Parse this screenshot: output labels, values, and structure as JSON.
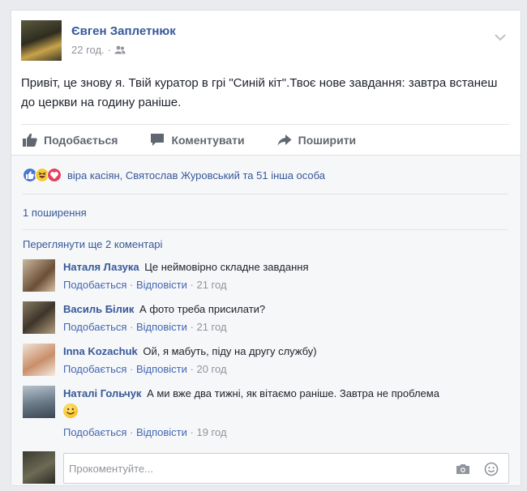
{
  "post": {
    "author": "Євген Заплетнюк",
    "time": "22 год.",
    "privacy_icon": "friends-icon",
    "text": "Привіт, це знову я. Твій куратор в грі \"Синій кіт\".Твоє нове завдання: завтра встанеш до церкви на годину раніше."
  },
  "actions": {
    "like": "Подобається",
    "comment": "Коментувати",
    "share": "Поширити"
  },
  "reactions": {
    "icons": [
      "like-icon",
      "haha-icon",
      "love-icon"
    ],
    "text": "віра касіян, Святослав Журовський та 51 інша особа"
  },
  "shares_text": "1 поширення",
  "view_more": "Переглянути ще 2 коментарі",
  "comments": [
    {
      "name": "Наталя Лазука",
      "text": "Це неймовірно складне завдання",
      "like": "Подобається",
      "reply": "Відповісти",
      "time": "21 год"
    },
    {
      "name": "Василь Білик",
      "text": "А фото треба присилати?",
      "like": "Подобається",
      "reply": "Відповісти",
      "time": "21 год"
    },
    {
      "name": "Inna Kozachuk",
      "text": "Ой, я мабуть, піду на другу службу)",
      "like": "Подобається",
      "reply": "Відповісти",
      "time": "20 год"
    },
    {
      "name": "Наталі Гольчук",
      "text": "А ми вже два тижні, як вітаємо раніше. Завтра не проблема",
      "like": "Подобається",
      "reply": "Відповісти",
      "time": "19 год"
    }
  ],
  "compose": {
    "placeholder": "Прокоментуйте..."
  },
  "colors": {
    "link": "#365899",
    "meta": "#90949c",
    "background": "#e9ebee"
  }
}
